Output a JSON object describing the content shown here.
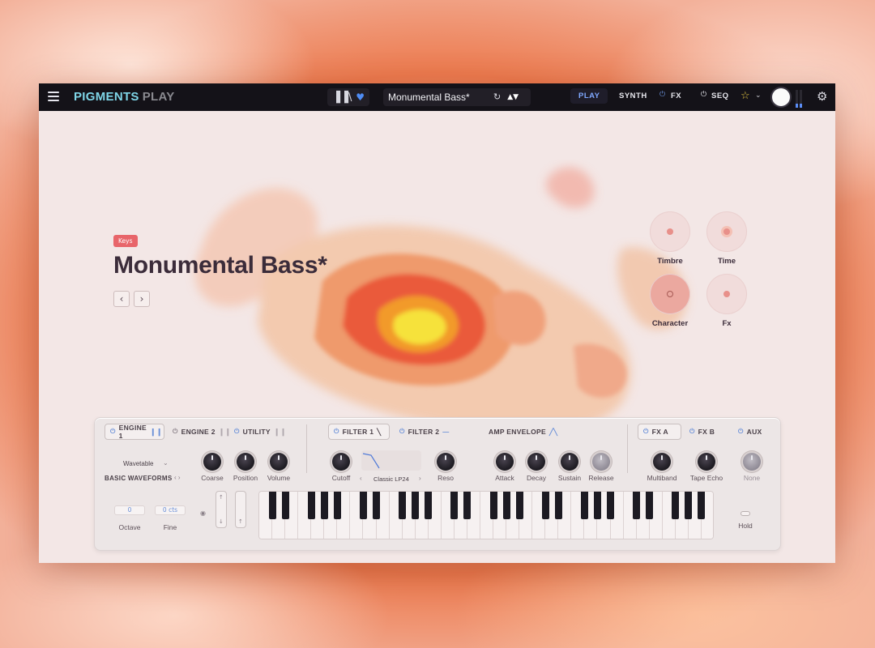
{
  "app": {
    "brand_primary": "PIGMENTS",
    "brand_secondary": "PLAY"
  },
  "topbar": {
    "preset_name": "Monumental Bass*",
    "tabs": [
      "PLAY",
      "SYNTH",
      "FX",
      "SEQ"
    ],
    "accent": "#7fa8ff"
  },
  "patch": {
    "tag": "Keys",
    "title": "Monumental Bass*"
  },
  "macros": [
    "Timbre",
    "Time",
    "Character",
    "Fx"
  ],
  "panel": {
    "tabs": {
      "engine1": "ENGINE 1",
      "engine2": "ENGINE 2",
      "utility": "UTILITY",
      "filter1": "FILTER 1",
      "filter2": "FILTER 2",
      "amp_env": "AMP ENVELOPE",
      "fxa": "FX A",
      "fxb": "FX B",
      "aux": "AUX"
    },
    "engine": {
      "type": "Wavetable",
      "wavetable": "BASIC WAVEFORMS",
      "knobs": [
        "Coarse",
        "Position",
        "Volume"
      ],
      "octave_value": "0",
      "octave_label": "Octave",
      "fine_value": "0 cts",
      "fine_label": "Fine"
    },
    "filter": {
      "knobs": [
        "Cutoff",
        "Reso"
      ],
      "type": "Classic LP24"
    },
    "envelope": {
      "knobs": [
        "Attack",
        "Decay",
        "Sustain",
        "Release"
      ]
    },
    "fx": {
      "knobs": [
        "Multiband",
        "Tape Echo",
        "None"
      ]
    },
    "hold": "Hold"
  }
}
